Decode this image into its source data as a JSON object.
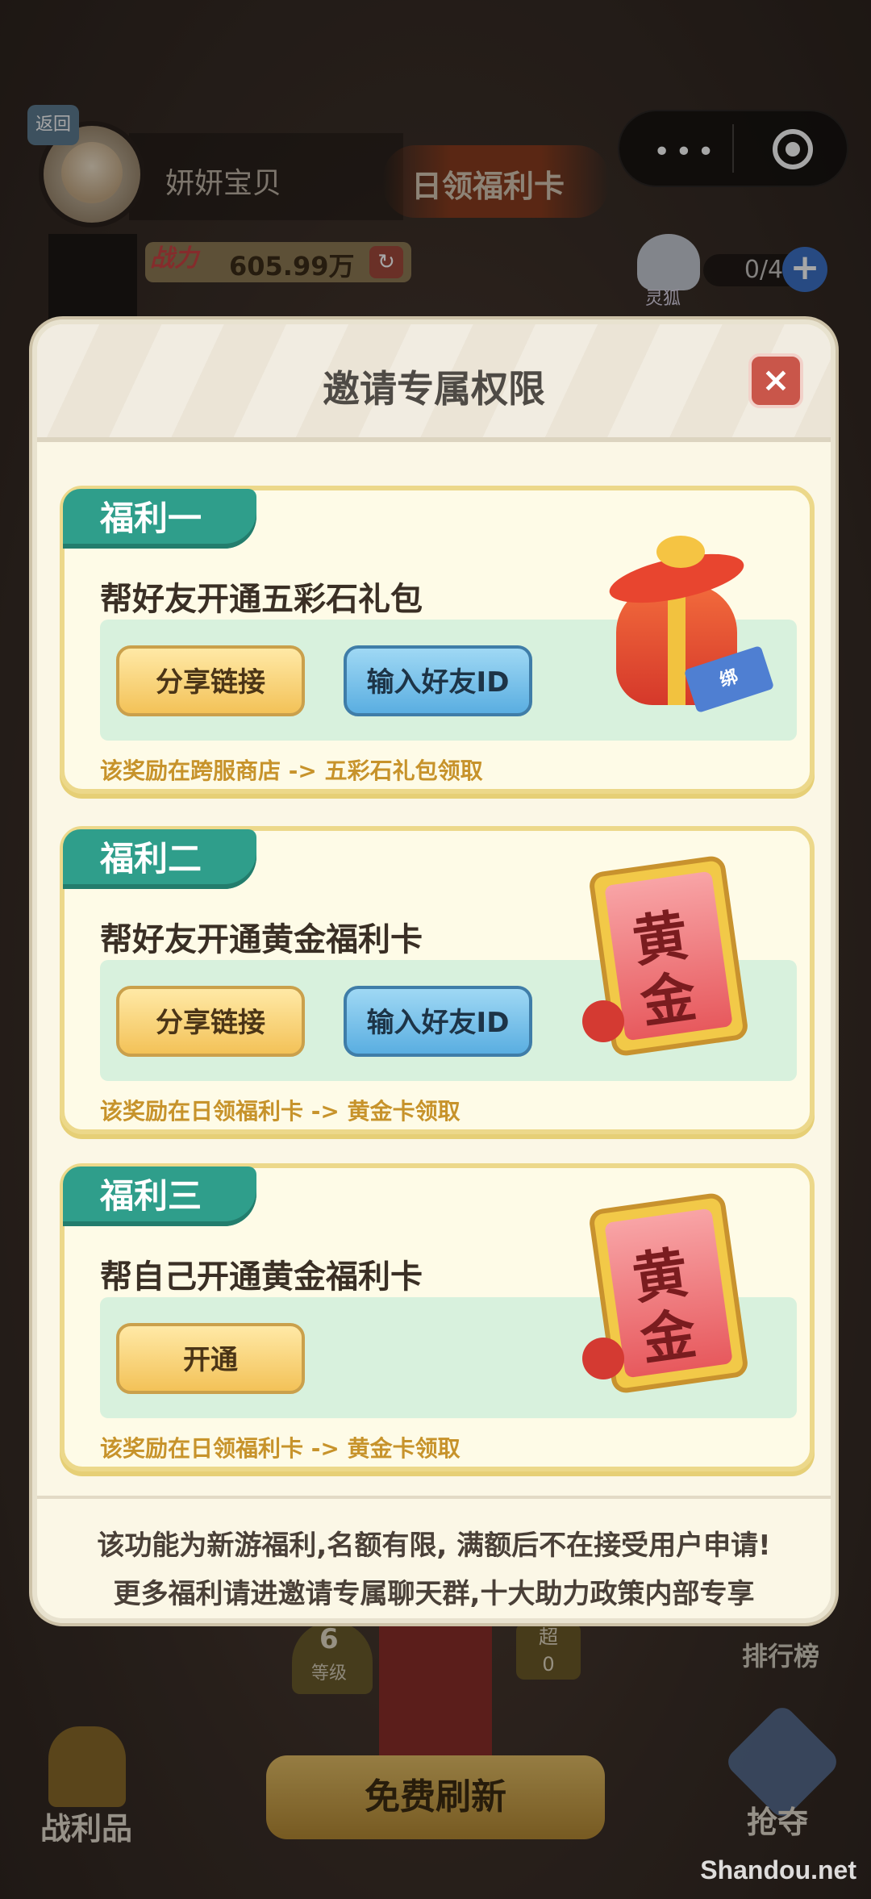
{
  "top": {
    "back_label": "返回",
    "player_name": "妍妍宝贝",
    "daily_card": "日领福利卡",
    "capsule_dots": "•••",
    "power_icon": "战力",
    "power_value": "605.99万",
    "fox_label": "灵狐",
    "fox_count": "0/4",
    "plus": "+"
  },
  "modal": {
    "title": "邀请专属权限",
    "close": "×",
    "benefits": [
      {
        "tag": "福利一",
        "title": "帮好友开通五彩石礼包",
        "buttons": [
          "分享链接",
          "输入好友ID"
        ],
        "note": "该奖励在跨服商店 -> 五彩石礼包领取",
        "bind_label": "绑"
      },
      {
        "tag": "福利二",
        "title": "帮好友开通黄金福利卡",
        "buttons": [
          "分享链接",
          "输入好友ID"
        ],
        "note": "该奖励在日领福利卡 -> 黄金卡领取",
        "card_text": [
          "黄",
          "金"
        ]
      },
      {
        "tag": "福利三",
        "title": "帮自己开通黄金福利卡",
        "buttons": [
          "开通"
        ],
        "note": "该奖励在日领福利卡 -> 黄金卡领取",
        "card_text": [
          "黄",
          "金"
        ]
      }
    ],
    "footer": [
      "该功能为新游福利,名额有限, 满额后不在接受用户申请!",
      "更多福利请进邀请专属聊天群,十大助力政策内部专享"
    ]
  },
  "bottom": {
    "level_num": "6",
    "level_label": "等级",
    "chao": "超",
    "chao_count": "0",
    "rank_label": "排行榜",
    "trophy_label": "战利品",
    "refresh": "免费刷新",
    "grab_label": "抢夺"
  },
  "watermark": "Shandou.net"
}
